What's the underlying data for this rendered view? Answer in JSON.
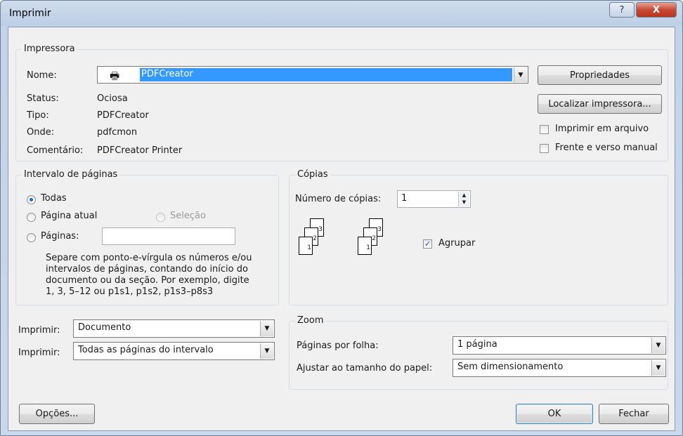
{
  "window": {
    "title": "Imprimir",
    "help_glyph": "?",
    "close_glyph": "X"
  },
  "printer": {
    "group_label": "Impressora",
    "name_label": "Nome:",
    "name_value": "PDFCreator",
    "status_label": "Status:",
    "status_value": "Ociosa",
    "type_label": "Tipo:",
    "type_value": "PDFCreator",
    "where_label": "Onde:",
    "where_value": "pdfcmon",
    "comment_label": "Comentário:",
    "comment_value": "PDFCreator Printer",
    "properties_button": "Propriedades",
    "find_printer_button": "Localizar impressora...",
    "print_to_file": {
      "label": "Imprimir em arquivo",
      "checked": false
    },
    "manual_duplex": {
      "label": "Frente e verso manual",
      "checked": false
    }
  },
  "page_range": {
    "group_label": "Intervalo de páginas",
    "all": {
      "label": "Todas",
      "selected": true
    },
    "current": {
      "label": "Página atual",
      "selected": false
    },
    "selection": {
      "label": "Seleção",
      "selected": false,
      "disabled": true
    },
    "pages": {
      "label": "Páginas:",
      "selected": false,
      "value": ""
    },
    "help_lines": [
      "Separe com ponto-e-vírgula os números e/ou",
      "intervalos de páginas, contando do início do",
      "documento ou da seção. Por exemplo, digite",
      "1, 3, 5–12 ou p1s1, p1s2, p1s3–p8s3"
    ]
  },
  "copies": {
    "group_label": "Cópias",
    "count_label": "Número de cópias:",
    "count_value": "1",
    "collate": {
      "label": "Agrupar",
      "checked": true
    },
    "page_numbers": [
      "3",
      "2",
      "1"
    ]
  },
  "print_what": {
    "label": "Imprimir:",
    "value": "Documento"
  },
  "print_range": {
    "label": "Imprimir:",
    "value": "Todas as páginas do intervalo"
  },
  "zoom": {
    "group_label": "Zoom",
    "pages_per_sheet_label": "Páginas por folha:",
    "pages_per_sheet_value": "1 página",
    "scale_label": "Ajustar ao tamanho do papel:",
    "scale_value": "Sem dimensionamento"
  },
  "footer": {
    "options_button": "Opções...",
    "ok_button": "OK",
    "close_button": "Fechar"
  },
  "colors": {
    "selection": "#3399ff",
    "title_close": "#c54a35"
  }
}
